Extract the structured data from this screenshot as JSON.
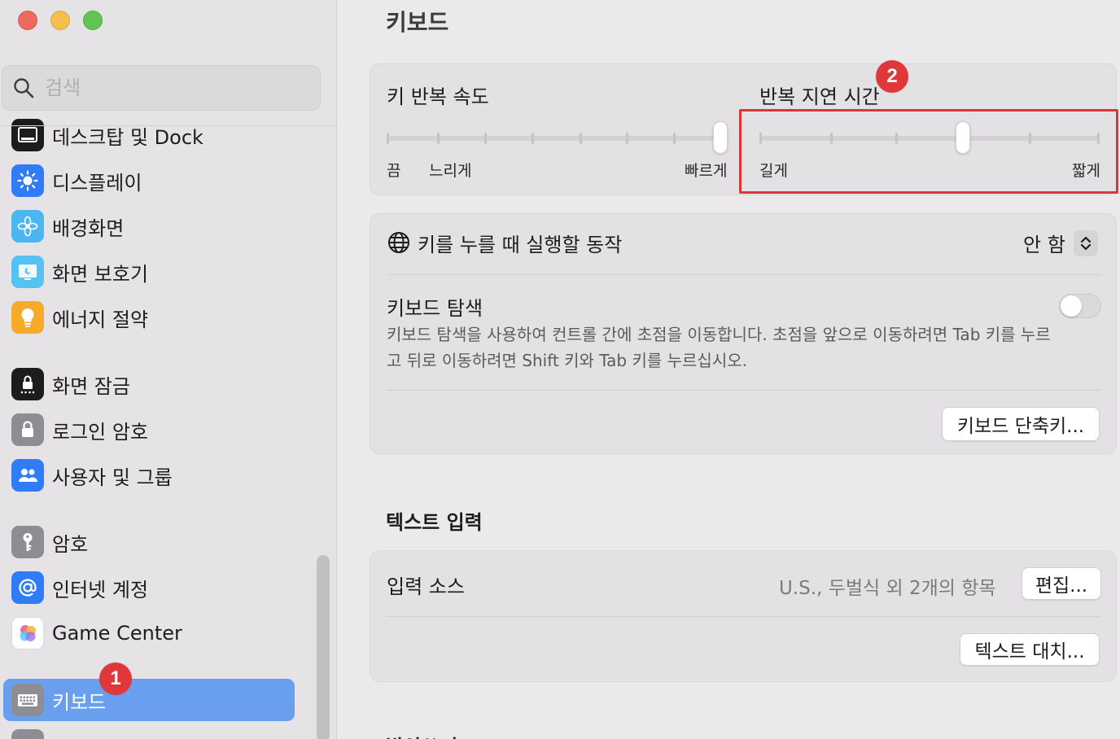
{
  "window": {
    "controls": [
      "close",
      "minimize",
      "zoom"
    ]
  },
  "sidebar": {
    "search_placeholder": "검색",
    "items": [
      {
        "label": "데스크탑 및 Dock",
        "icon": "dock-icon",
        "color": "#1c1c1e"
      },
      {
        "label": "디스플레이",
        "icon": "display-sun-icon",
        "color": "#2f7cf6"
      },
      {
        "label": "배경화면",
        "icon": "wallpaper-flower-icon",
        "color": "#4ab7f0"
      },
      {
        "label": "화면 보호기",
        "icon": "screensaver-icon",
        "color": "#56c2f2"
      },
      {
        "label": "에너지 절약",
        "icon": "energy-bulb-icon",
        "color": "#f7a928"
      },
      {
        "label": "화면 잠금",
        "icon": "lock-screen-icon",
        "color": "#1c1c1e"
      },
      {
        "label": "로그인 암호",
        "icon": "login-lock-icon",
        "color": "#8e8d92"
      },
      {
        "label": "사용자 및 그룹",
        "icon": "users-groups-icon",
        "color": "#2f7cf6"
      },
      {
        "label": "암호",
        "icon": "key-icon",
        "color": "#8e8d92"
      },
      {
        "label": "인터넷 계정",
        "icon": "at-sign-icon",
        "color": "#2f7cf6"
      },
      {
        "label": "Game Center",
        "icon": "game-center-icon",
        "color": "#ffffff"
      },
      {
        "label": "키보드",
        "icon": "keyboard-icon",
        "color": "#8e8d92",
        "selected": true
      }
    ],
    "badge_1": "1"
  },
  "main": {
    "title": "키보드",
    "key_repeat": {
      "title": "키 반복 속도",
      "min_label": "끔",
      "slow_label": "느리게",
      "max_label": "빠르게",
      "value": 1.0
    },
    "repeat_delay": {
      "title": "반복 지연 시간",
      "min_label": "길게",
      "max_label": "짧게",
      "value": 0.6
    },
    "badge_2": "2",
    "globe_action": {
      "label": "키를 누를 때 실행할 동작",
      "value": "안 함"
    },
    "keyboard_nav": {
      "title": "키보드 탐색",
      "description": "키보드 탐색을 사용하여 컨트롤 간에 초점을 이동합니다. 초점을 앞으로 이동하려면 Tab 키를 누르고 뒤로 이동하려면 Shift 키와 Tab 키를 누르십시오.",
      "enabled": false
    },
    "shortcuts_button": "키보드 단축키...",
    "text_input": {
      "section_title": "텍스트 입력",
      "input_sources_label": "입력 소스",
      "input_sources_value": "U.S., 두벌식 외 2개의 항목",
      "edit_button": "편집...",
      "text_replace_button": "텍스트 대치..."
    },
    "next_section_title": "받아쓰기"
  }
}
